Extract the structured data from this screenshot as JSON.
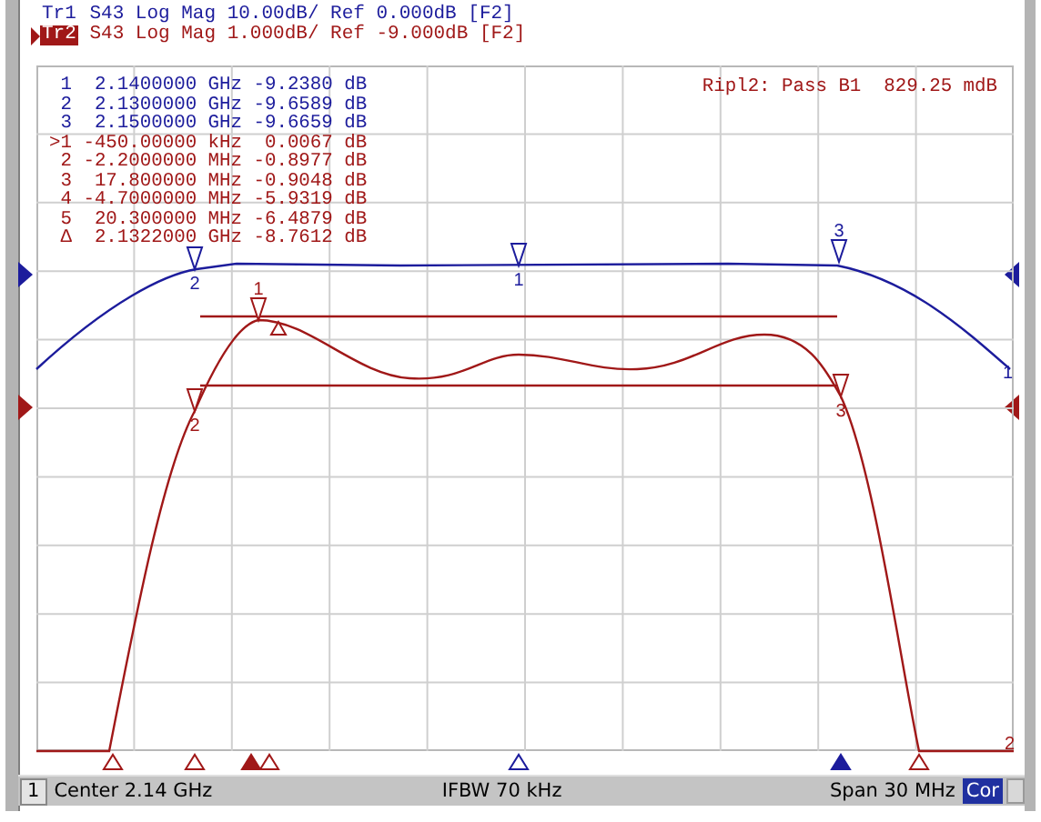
{
  "traces": [
    {
      "label": "Tr1",
      "text": "S43 Log Mag 10.00dB/ Ref 0.000dB [F2]",
      "color": "#1c1c9c",
      "active": false
    },
    {
      "label": "Tr2",
      "text": "S43 Log Mag 1.000dB/ Ref -9.000dB [F2]",
      "color": "#a01818",
      "active": true
    }
  ],
  "marker_table": [
    {
      "line": " 1  2.1400000 GHz -9.2380 dB",
      "color": "#1c1c9c"
    },
    {
      "line": " 2  2.1300000 GHz -9.6589 dB",
      "color": "#1c1c9c"
    },
    {
      "line": " 3  2.1500000 GHz -9.6659 dB",
      "color": "#1c1c9c"
    },
    {
      "line": ">1 -450.00000 kHz  0.0067 dB",
      "color": "#a01818"
    },
    {
      "line": " 2 -2.2000000 MHz -0.8977 dB",
      "color": "#a01818"
    },
    {
      "line": " 3  17.800000 MHz -0.9048 dB",
      "color": "#a01818"
    },
    {
      "line": " 4 -4.7000000 MHz -5.9319 dB",
      "color": "#a01818"
    },
    {
      "line": " 5  20.300000 MHz -6.4879 dB",
      "color": "#a01818"
    },
    {
      "line": " Δ  2.1322000 GHz -8.7612 dB",
      "color": "#a01818"
    }
  ],
  "ripple_readout": "Ripl2: Pass B1  829.25 mdB",
  "plot_markers": [
    {
      "label": "2",
      "color": "#1c1c9c"
    },
    {
      "label": "1",
      "color": "#1c1c9c"
    },
    {
      "label": "3",
      "color": "#1c1c9c"
    },
    {
      "label": "1",
      "color": "#a01818"
    },
    {
      "label": "2",
      "color": "#a01818"
    },
    {
      "label": "3",
      "color": "#a01818"
    }
  ],
  "trace_end_labels": [
    {
      "label": "1",
      "color": "#1c1c9c"
    },
    {
      "label": "2",
      "color": "#a01818"
    }
  ],
  "status_bar": {
    "channel": "1",
    "center": "Center 2.14 GHz",
    "ifbw": "IFBW 70 kHz",
    "span": "Span 30 MHz",
    "correction": "Cor"
  }
}
